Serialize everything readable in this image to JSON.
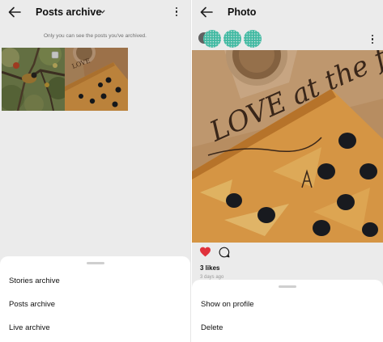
{
  "left_screen": {
    "title": "Posts archive",
    "notice": "Only you can see the posts you've archived.",
    "sheet": {
      "items": [
        "Stories archive",
        "Posts archive",
        "Live archive"
      ]
    }
  },
  "right_screen": {
    "title": "Photo",
    "post_text": "LOVE at the first BITE",
    "likes": "3 likes",
    "time_ago": "3 days ago",
    "sheet": {
      "items": [
        "Show on profile",
        "Delete"
      ]
    }
  },
  "colors": {
    "like_heart": "#e0323c",
    "pizza_crust": "#e8a24a",
    "olive": "#1b1d22",
    "board": "#c79a6a",
    "privacy_dots": "#46c9b0"
  },
  "icons": [
    "back-arrow-icon",
    "chevron-down-icon",
    "more-options-icon",
    "heart-icon",
    "comment-icon",
    "select-circle-icon"
  ]
}
